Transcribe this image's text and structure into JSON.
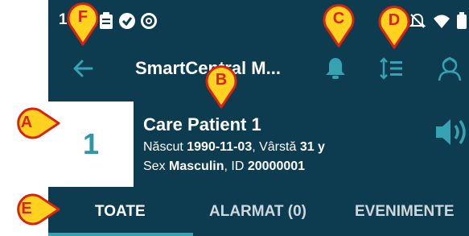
{
  "status_bar": {
    "time": "1"
  },
  "appbar": {
    "title": "SmartCentral M..."
  },
  "patient": {
    "bed": "1",
    "name": "Care Patient 1",
    "born_label": "Născut",
    "born_date": "1990-11-03",
    "age_label": ", Vârstă",
    "age_value": "31 y",
    "sex_label": "Sex",
    "sex_value": "Masculin",
    "id_label": ", ID",
    "id_value": "20000001"
  },
  "tabs": [
    {
      "label": "TOATE"
    },
    {
      "label": "ALARMAT (0)"
    },
    {
      "label": "EVENIMENTE"
    }
  ],
  "callouts": {
    "a": "A",
    "b": "B",
    "c": "C",
    "d": "D",
    "e": "E",
    "f": "F"
  },
  "colors": {
    "header_bg": "#0d3b4f",
    "accent": "#36a3b5",
    "callout_fill": "#ffd21f",
    "callout_text": "#d9230f"
  }
}
